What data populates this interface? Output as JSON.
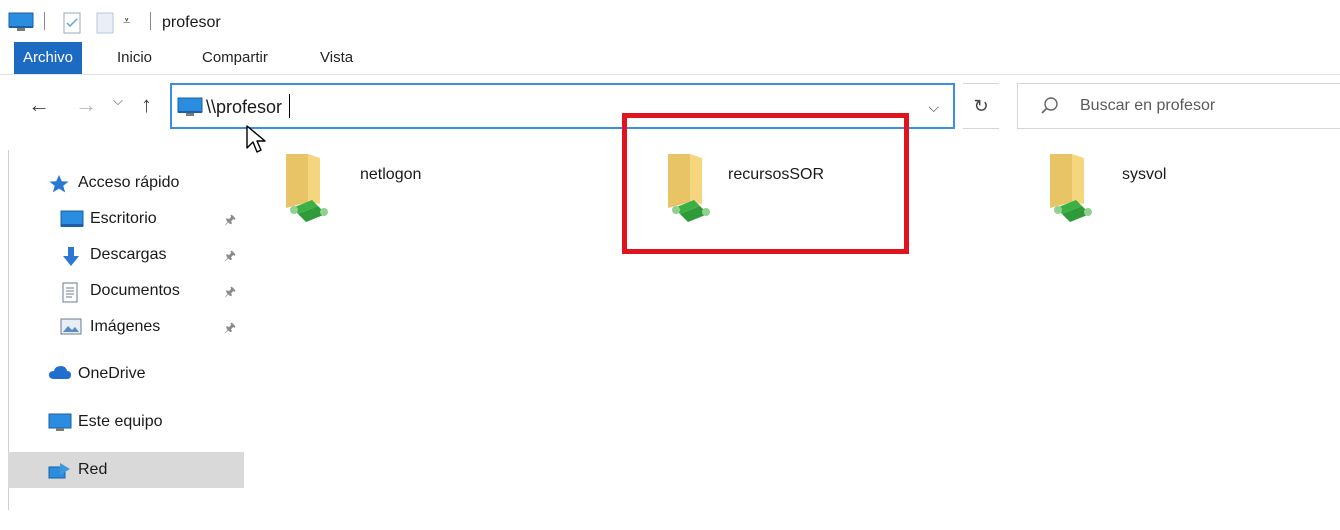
{
  "window": {
    "title": "profesor"
  },
  "ribbon": {
    "tabs": [
      {
        "label": "Archivo",
        "active": true
      },
      {
        "label": "Inicio",
        "active": false
      },
      {
        "label": "Compartir",
        "active": false
      },
      {
        "label": "Vista",
        "active": false
      }
    ]
  },
  "address": {
    "value": "\\\\profesor"
  },
  "search": {
    "placeholder": "Buscar en profesor"
  },
  "sidebar": {
    "items": [
      {
        "label": "Acceso rápido",
        "icon": "star-icon"
      },
      {
        "label": "Escritorio",
        "icon": "desktop-icon",
        "pinned": true
      },
      {
        "label": "Descargas",
        "icon": "download-icon",
        "pinned": true
      },
      {
        "label": "Documentos",
        "icon": "document-icon",
        "pinned": true
      },
      {
        "label": "Imágenes",
        "icon": "pictures-icon",
        "pinned": true
      },
      {
        "label": "OneDrive",
        "icon": "cloud-icon"
      },
      {
        "label": "Este equipo",
        "icon": "computer-icon"
      },
      {
        "label": "Red",
        "icon": "network-icon",
        "selected": true
      }
    ]
  },
  "shares": [
    {
      "name": "netlogon"
    },
    {
      "name": "recursosSOR"
    },
    {
      "name": "sysvol"
    }
  ],
  "colors": {
    "accent": "#1d6ac3",
    "highlight": "#e0141e",
    "folder": "#f2c94c",
    "share_green": "#3cb043"
  }
}
